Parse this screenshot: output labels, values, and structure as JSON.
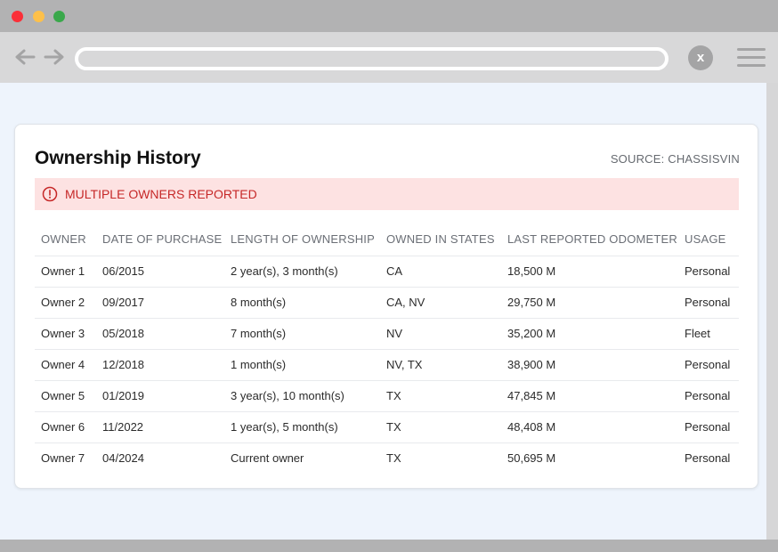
{
  "window": {
    "controls": [
      "close",
      "minimize",
      "maximize"
    ],
    "colors": {
      "close": "#fa2f38",
      "minimize": "#fdc04a",
      "maximize": "#3aa84b"
    }
  },
  "toolbar": {
    "back_icon": "arrow-left-icon",
    "forward_icon": "arrow-right-icon",
    "address_value": "",
    "close_label": "x",
    "menu_icon": "hamburger-menu-icon"
  },
  "card": {
    "title": "Ownership History",
    "source": "SOURCE: CHASSISVIN",
    "alert": {
      "icon": "alert-circle-icon",
      "text": "MULTIPLE OWNERS REPORTED",
      "color": "#c62828",
      "background": "#fde2e2"
    }
  },
  "table": {
    "columns": [
      "OWNER",
      "DATE OF PURCHASE",
      "LENGTH OF OWNERSHIP",
      "OWNED IN STATES",
      "LAST REPORTED ODOMETER",
      "USAGE"
    ],
    "rows": [
      [
        "Owner 1",
        "06/2015",
        "2 year(s), 3 month(s)",
        "CA",
        "18,500 M",
        "Personal"
      ],
      [
        "Owner 2",
        "09/2017",
        "8 month(s)",
        "CA, NV",
        "29,750 M",
        "Personal"
      ],
      [
        "Owner 3",
        "05/2018",
        "7 month(s)",
        "NV",
        "35,200 M",
        "Fleet"
      ],
      [
        "Owner 4",
        "12/2018",
        "1 month(s)",
        "NV, TX",
        "38,900 M",
        "Personal"
      ],
      [
        "Owner 5",
        "01/2019",
        "3 year(s), 10 month(s)",
        "TX",
        "47,845 M",
        "Personal"
      ],
      [
        "Owner 6",
        "11/2022",
        "1 year(s), 5 month(s)",
        "TX",
        "48,408 M",
        "Personal"
      ],
      [
        "Owner 7",
        "04/2024",
        "Current owner",
        "TX",
        "50,695 M",
        "Personal"
      ]
    ]
  }
}
